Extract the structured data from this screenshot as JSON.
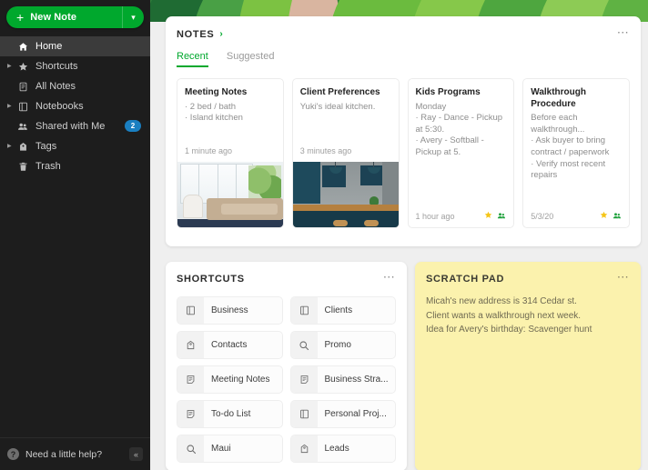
{
  "sidebar": {
    "new_note": {
      "label": "New Note",
      "plus_icon": "plus-icon",
      "chevron_icon": "chevron-down-icon"
    },
    "items": [
      {
        "label": "Home",
        "icon": "home-icon",
        "expandable": false,
        "active": true,
        "badge": ""
      },
      {
        "label": "Shortcuts",
        "icon": "star-icon",
        "expandable": true,
        "active": false,
        "badge": ""
      },
      {
        "label": "All Notes",
        "icon": "note-icon",
        "expandable": false,
        "active": false,
        "badge": ""
      },
      {
        "label": "Notebooks",
        "icon": "notebook-icon",
        "expandable": true,
        "active": false,
        "badge": ""
      },
      {
        "label": "Shared with Me",
        "icon": "people-icon",
        "expandable": false,
        "active": false,
        "badge": "2"
      },
      {
        "label": "Tags",
        "icon": "tag-icon",
        "expandable": true,
        "active": false,
        "badge": ""
      },
      {
        "label": "Trash",
        "icon": "trash-icon",
        "expandable": false,
        "active": false,
        "badge": ""
      }
    ],
    "help": {
      "label": "Need a little help?",
      "icon": "question-circle-icon",
      "collapse_icon": "collapse-left-icon",
      "collapse_glyph": "«"
    }
  },
  "notes_panel": {
    "title": "NOTES",
    "caret": "›",
    "menu_icon": "kebab-menu-icon",
    "tabs": [
      {
        "label": "Recent",
        "active": true
      },
      {
        "label": "Suggested",
        "active": false
      }
    ],
    "cards": [
      {
        "title": "Meeting Notes",
        "lines": [
          "· 2 bed / bath",
          "· Island kitchen"
        ],
        "timestamp": "1 minute ago",
        "starred": false,
        "shared": false,
        "thumb": "living-room-photo"
      },
      {
        "title": "Client Preferences",
        "lines": [
          "Yuki's ideal kitchen."
        ],
        "timestamp": "3 minutes ago",
        "starred": false,
        "shared": false,
        "thumb": "kitchen-photo"
      },
      {
        "title": "Kids Programs",
        "lines": [
          "Monday",
          "· Ray - Dance - Pickup at 5:30.",
          "· Avery - Softball - Pickup at 5."
        ],
        "timestamp": "1 hour ago",
        "starred": true,
        "shared": true,
        "thumb": ""
      },
      {
        "title": "Walkthrough Procedure",
        "lines": [
          "Before each walkthrough...",
          "· Ask buyer to bring contract / paperwork",
          "· Verify most recent repairs"
        ],
        "timestamp": "5/3/20",
        "starred": true,
        "shared": true,
        "thumb": ""
      }
    ]
  },
  "shortcuts_panel": {
    "title": "SHORTCUTS",
    "menu_icon": "kebab-menu-icon",
    "items": [
      {
        "label": "Business",
        "icon": "notebook-icon"
      },
      {
        "label": "Clients",
        "icon": "notebook-icon"
      },
      {
        "label": "Contacts",
        "icon": "tag-icon"
      },
      {
        "label": "Promo",
        "icon": "search-icon"
      },
      {
        "label": "Meeting Notes",
        "icon": "note-icon"
      },
      {
        "label": "Business Stra...",
        "icon": "note-icon"
      },
      {
        "label": "To-do List",
        "icon": "note-icon"
      },
      {
        "label": "Personal Proj...",
        "icon": "notebook-icon"
      },
      {
        "label": "Maui",
        "icon": "search-icon"
      },
      {
        "label": "Leads",
        "icon": "tag-icon"
      }
    ]
  },
  "scratch_panel": {
    "title": "SCRATCH PAD",
    "menu_icon": "kebab-menu-icon",
    "lines": [
      "Micah's new address is 314 Cedar st.",
      "Client wants a walkthrough next week.",
      "Idea for Avery's birthday: Scavenger hunt"
    ]
  },
  "colors": {
    "brand_green": "#00a82d",
    "sidebar_bg": "#1d1d1d",
    "badge_blue": "#1a7fc1",
    "scratch_yellow": "#fbf2ad",
    "star_yellow": "#f5c518",
    "page_bg": "#efefef"
  }
}
